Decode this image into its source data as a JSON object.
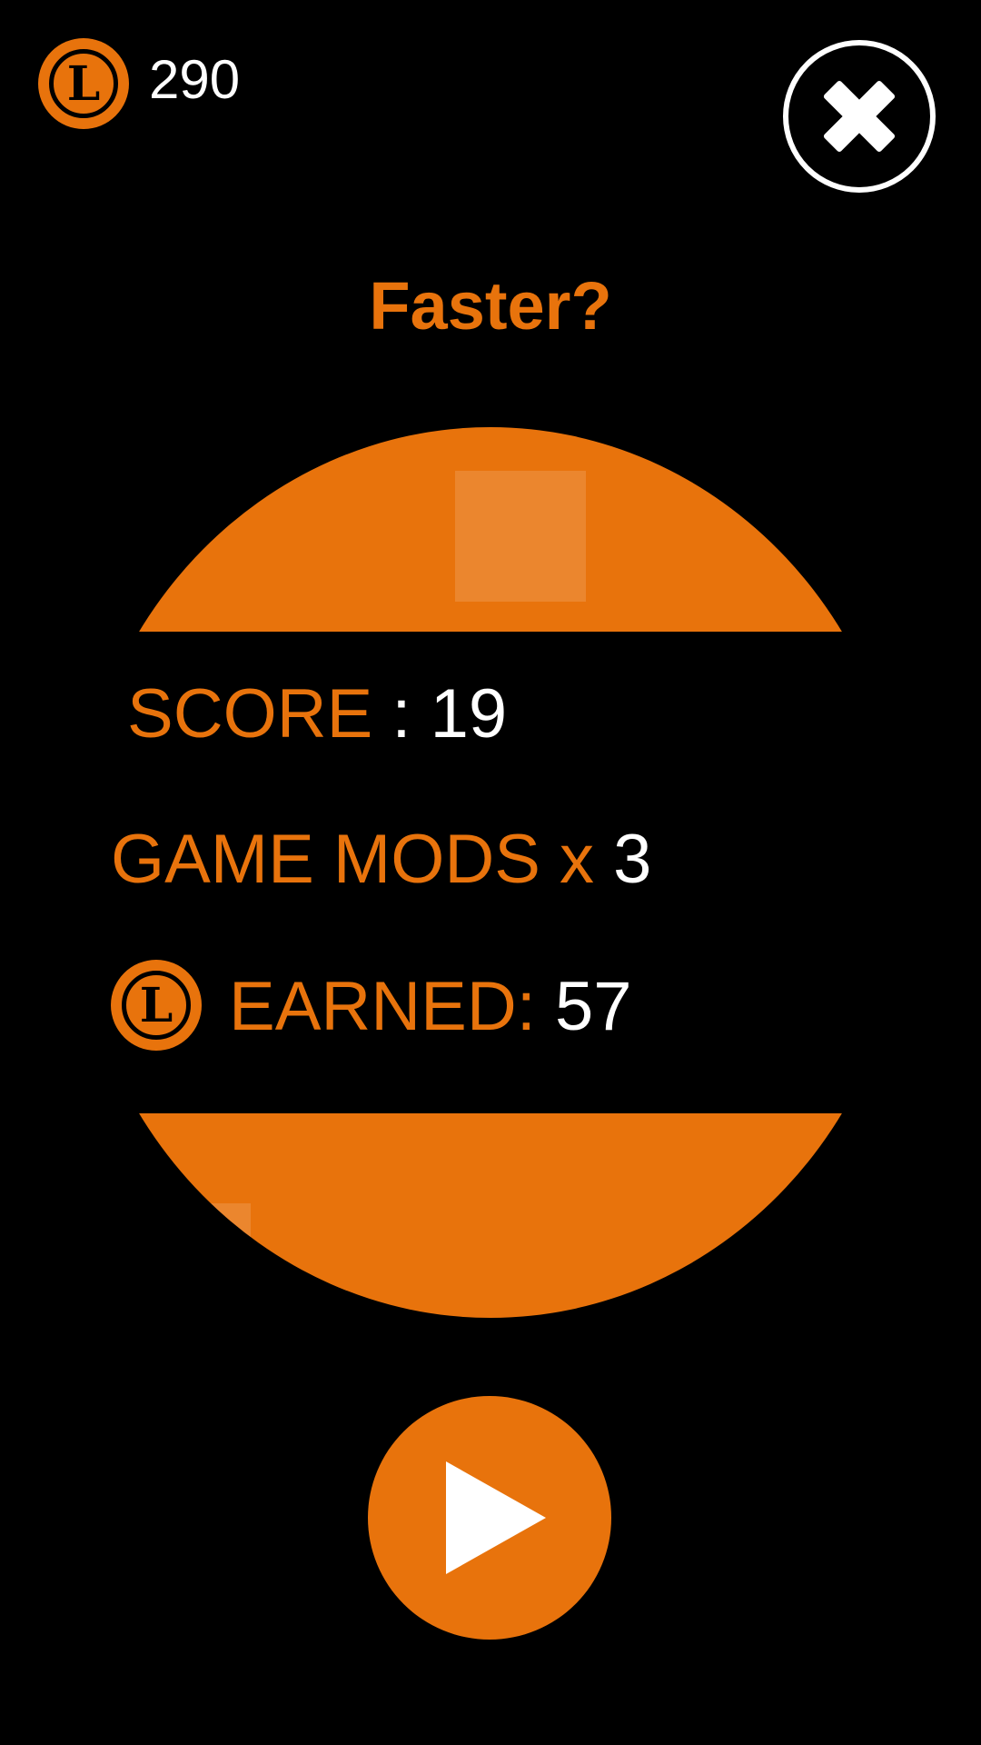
{
  "header": {
    "coin_icon": "coin-icon",
    "coin_letter": "L",
    "balance": "290",
    "close_icon": "close-icon"
  },
  "title": "Faster?",
  "results": {
    "score_label": "SCORE",
    "score_separator": " : ",
    "score_value": "19",
    "mods_label": "GAME MODS x ",
    "mods_value": "3",
    "earned_label": "EARNED: ",
    "earned_value": "57"
  },
  "play_icon": "play-icon",
  "colors": {
    "accent": "#E8730C",
    "background": "#000000",
    "text": "#FFFFFF"
  }
}
